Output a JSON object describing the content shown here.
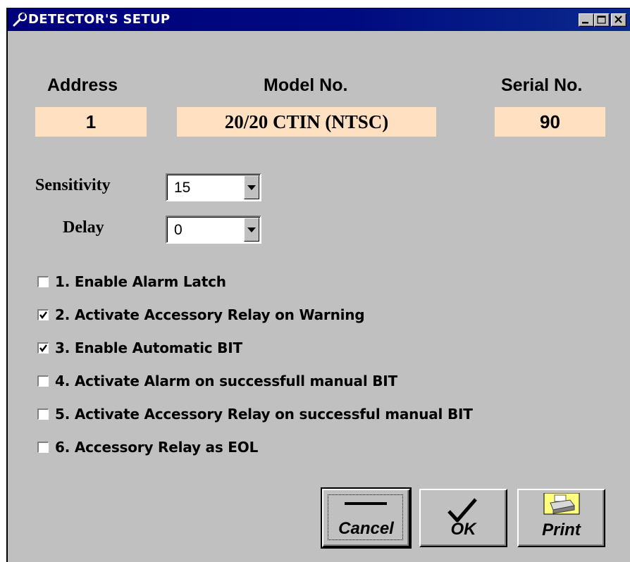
{
  "window": {
    "title": "DETECTOR'S SETUP",
    "icon": "wrench-icon",
    "title_bar_color": "#000080",
    "controls": [
      "minimize-icon",
      "maximize-icon",
      "close-icon"
    ]
  },
  "info": {
    "address_label": "Address",
    "address_value": "1",
    "model_label": "Model No.",
    "model_value": "20/20 CTIN (NTSC)",
    "serial_label": "Serial No.",
    "serial_value": "90",
    "value_box_color": "#ffe0c0"
  },
  "sensitivity": {
    "label": "Sensitivity",
    "value": "15"
  },
  "delay": {
    "label": "Delay",
    "value": "0"
  },
  "options": [
    {
      "label": "1. Enable Alarm Latch",
      "checked": false
    },
    {
      "label": "2. Activate Accessory Relay on Warning",
      "checked": true
    },
    {
      "label": "3. Enable Automatic BIT",
      "checked": true
    },
    {
      "label": "4. Activate Alarm on successfull manual BIT",
      "checked": false
    },
    {
      "label": "5. Activate Accessory Relay on successful manual BIT",
      "checked": false
    },
    {
      "label": "6. Accessory Relay as EOL",
      "checked": false
    }
  ],
  "buttons": {
    "cancel": {
      "label": "Cancel",
      "icon": "dash-icon"
    },
    "ok": {
      "label": "OK",
      "icon": "checkmark-icon"
    },
    "print": {
      "label": "Print",
      "icon": "printer-icon"
    }
  }
}
